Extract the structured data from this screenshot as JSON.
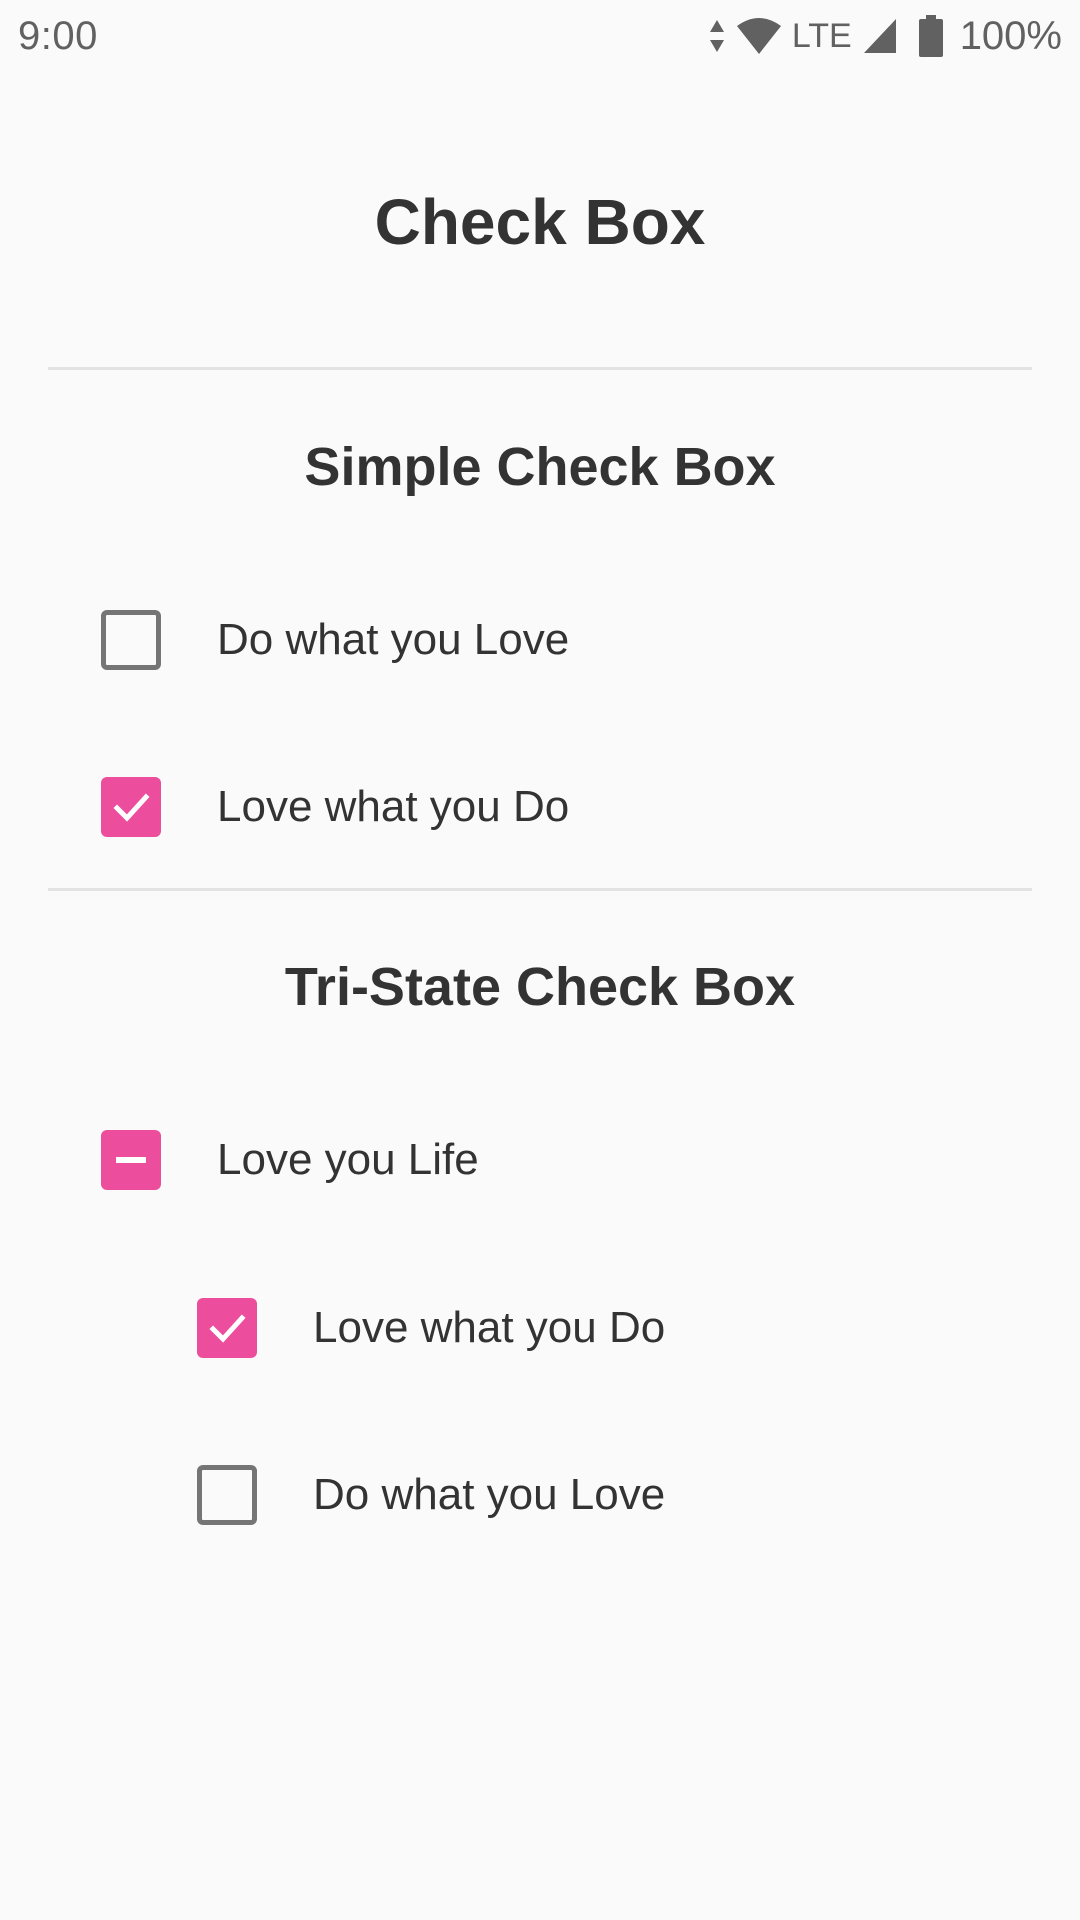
{
  "status_bar": {
    "time": "9:00",
    "network": "LTE",
    "battery": "100%",
    "icons": [
      "data-arrows-icon",
      "wifi-icon",
      "signal-icon",
      "battery-icon"
    ]
  },
  "page": {
    "title": "Check Box"
  },
  "simple_section": {
    "title": "Simple Check Box",
    "items": [
      {
        "label": "Do what you Love",
        "state": "unchecked"
      },
      {
        "label": "Love what you Do",
        "state": "checked"
      }
    ]
  },
  "tristate_section": {
    "title": "Tri-State Check Box",
    "parent": {
      "label": "Love you Life",
      "state": "indeterminate"
    },
    "children": [
      {
        "label": "Love what you Do",
        "state": "checked"
      },
      {
        "label": "Do what you Love",
        "state": "unchecked"
      }
    ]
  },
  "colors": {
    "accent": "#EC4D9C",
    "unchecked_border": "#757575",
    "text": "#333333",
    "divider": "#E3E3E3",
    "background": "#FAFAFA"
  }
}
